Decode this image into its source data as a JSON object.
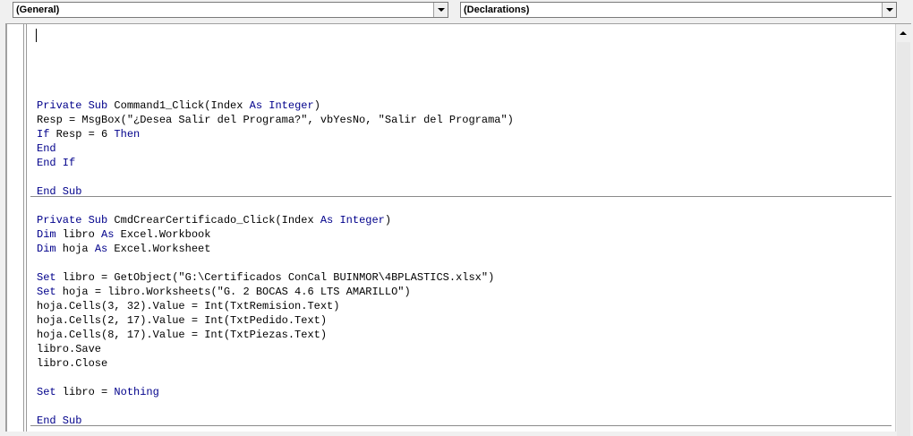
{
  "combos": {
    "object": "(General)",
    "procedure": "(Declarations)"
  },
  "code": [
    [
      {
        "t": "Private Sub",
        "k": 1
      },
      {
        "t": " Command1_Click(Index "
      },
      {
        "t": "As",
        "k": 1
      },
      {
        "t": " "
      },
      {
        "t": "Integer",
        "k": 1
      },
      {
        "t": ")"
      }
    ],
    [
      {
        "t": "Resp = MsgBox(\"¿Desea Salir del Programa?\", vbYesNo, \"Salir del Programa\")"
      }
    ],
    [
      {
        "t": "If",
        "k": 1
      },
      {
        "t": " Resp = 6 "
      },
      {
        "t": "Then",
        "k": 1
      }
    ],
    [
      {
        "t": "End",
        "k": 1
      }
    ],
    [
      {
        "t": "End If",
        "k": 1
      }
    ],
    [],
    [
      {
        "t": "End Sub",
        "k": 1
      }
    ],
    [],
    [
      {
        "t": "Private Sub",
        "k": 1
      },
      {
        "t": " CmdCrearCertificado_Click(Index "
      },
      {
        "t": "As",
        "k": 1
      },
      {
        "t": " "
      },
      {
        "t": "Integer",
        "k": 1
      },
      {
        "t": ")"
      }
    ],
    [
      {
        "t": "Dim",
        "k": 1
      },
      {
        "t": " libro "
      },
      {
        "t": "As",
        "k": 1
      },
      {
        "t": " Excel.Workbook"
      }
    ],
    [
      {
        "t": "Dim",
        "k": 1
      },
      {
        "t": " hoja "
      },
      {
        "t": "As",
        "k": 1
      },
      {
        "t": " Excel.Worksheet"
      }
    ],
    [],
    [
      {
        "t": "Set",
        "k": 1
      },
      {
        "t": " libro = GetObject(\"G:\\Certificados ConCal BUINMOR\\4BPLASTICS.xlsx\")"
      }
    ],
    [
      {
        "t": "Set",
        "k": 1
      },
      {
        "t": " hoja = libro.Worksheets(\"G. 2 BOCAS 4.6 LTS AMARILLO\")"
      }
    ],
    [
      {
        "t": "hoja.Cells(3, 32).Value = Int(TxtRemision.Text)"
      }
    ],
    [
      {
        "t": "hoja.Cells(2, 17).Value = Int(TxtPedido.Text)"
      }
    ],
    [
      {
        "t": "hoja.Cells(8, 17).Value = Int(TxtPiezas.Text)"
      }
    ],
    [
      {
        "t": "libro.Save"
      }
    ],
    [
      {
        "t": "libro.Close"
      }
    ],
    [],
    [
      {
        "t": "Set",
        "k": 1
      },
      {
        "t": " libro = "
      },
      {
        "t": "Nothing",
        "k": 1
      }
    ],
    [],
    [
      {
        "t": "End Sub",
        "k": 1
      }
    ]
  ]
}
